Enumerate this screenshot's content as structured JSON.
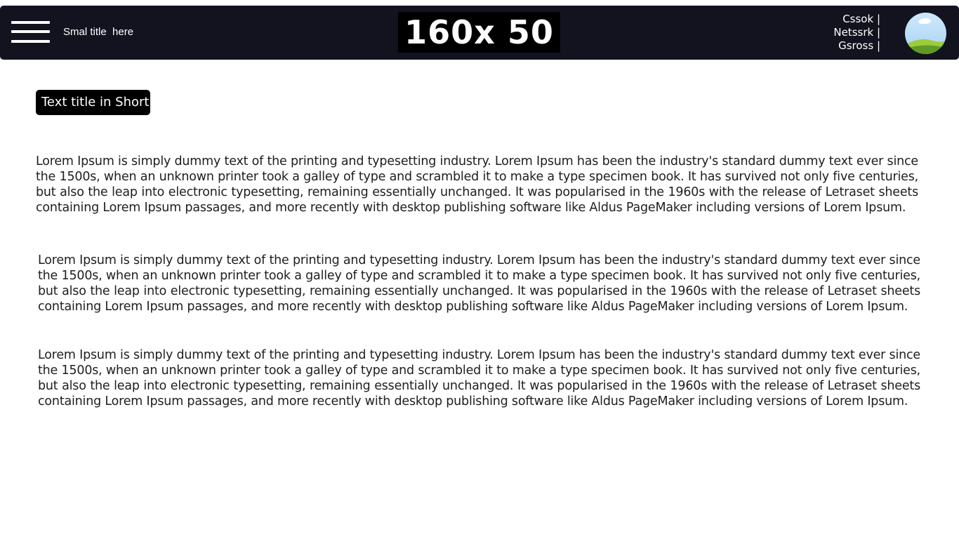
{
  "header": {
    "small_title": "Smal title  here",
    "logo_text": "160x 50",
    "nav_links": [
      "Cssok |",
      "Netssrk |",
      "Gsross |"
    ],
    "menu_icon": "hamburger-menu-icon",
    "avatar_icon": "landscape-avatar"
  },
  "main": {
    "tag_label": "Text title in Short",
    "paragraphs": [
      "Lorem Ipsum is simply dummy text of the printing and typesetting industry. Lorem Ipsum has been the industry's standard dummy text ever since the 1500s, when an unknown printer took a galley of type and scrambled it to make a type specimen book. It has survived not only five centuries, but also the leap into electronic typesetting, remaining essentially unchanged. It was popularised in the 1960s with the release of Letraset sheets containing Lorem Ipsum passages, and more recently with desktop publishing software like Aldus PageMaker including versions of Lorem Ipsum.",
      "Lorem Ipsum is simply dummy text of the printing and typesetting industry. Lorem Ipsum has been the industry's standard dummy text ever since the 1500s, when an unknown printer took a galley of type and scrambled it to make a type specimen book. It has survived not only five centuries, but also the leap into electronic typesetting, remaining essentially unchanged. It was popularised in the 1960s with the release of Letraset sheets containing Lorem Ipsum passages, and more recently with desktop publishing software like Aldus PageMaker including versions of Lorem Ipsum.",
      "Lorem Ipsum is simply dummy text of the printing and typesetting industry. Lorem Ipsum has been the industry's standard dummy text ever since the 1500s, when an unknown printer took a galley of type and scrambled it to make a type specimen book. It has survived not only five centuries, but also the leap into electronic typesetting, remaining essentially unchanged. It was popularised in the 1960s with the release of Letraset sheets containing Lorem Ipsum passages, and more recently with desktop publishing software like Aldus PageMaker including versions of Lorem Ipsum."
    ]
  },
  "colors": {
    "header_bg": "#12131e",
    "text": "#1e1e1e",
    "pill_bg": "#000000"
  }
}
